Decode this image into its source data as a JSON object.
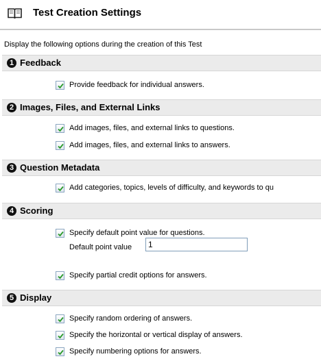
{
  "header": {
    "title": "Test Creation Settings",
    "icon": "book-icon"
  },
  "intro": "Display the following options during the creation of this Test",
  "sections": [
    {
      "number": "1",
      "title": "Feedback",
      "options": [
        {
          "label": "Provide feedback for individual answers.",
          "checked": true
        }
      ]
    },
    {
      "number": "2",
      "title": "Images, Files, and External Links",
      "options": [
        {
          "label": "Add images, files, and external links to questions.",
          "checked": true
        },
        {
          "label": "Add images, files, and external links to answers.",
          "checked": true
        }
      ]
    },
    {
      "number": "3",
      "title": "Question Metadata",
      "options": [
        {
          "label": "Add categories, topics, levels of difficulty, and keywords to qu",
          "checked": true
        }
      ]
    },
    {
      "number": "4",
      "title": "Scoring",
      "options": [
        {
          "label": "Specify default point value for questions.",
          "checked": true
        },
        {
          "label": "Specify partial credit options for answers.",
          "checked": true
        }
      ],
      "default_point": {
        "label": "Default point value",
        "value": "1"
      }
    },
    {
      "number": "5",
      "title": "Display",
      "options": [
        {
          "label": "Specify random ordering of answers.",
          "checked": true
        },
        {
          "label": "Specify the horizontal or vertical display of answers.",
          "checked": true
        },
        {
          "label": "Specify numbering options for answers.",
          "checked": true
        }
      ]
    }
  ],
  "colors": {
    "section_bg": "#ebebeb",
    "checkbox_border": "#8aa5c0",
    "check_mark": "#2a9a2a"
  }
}
